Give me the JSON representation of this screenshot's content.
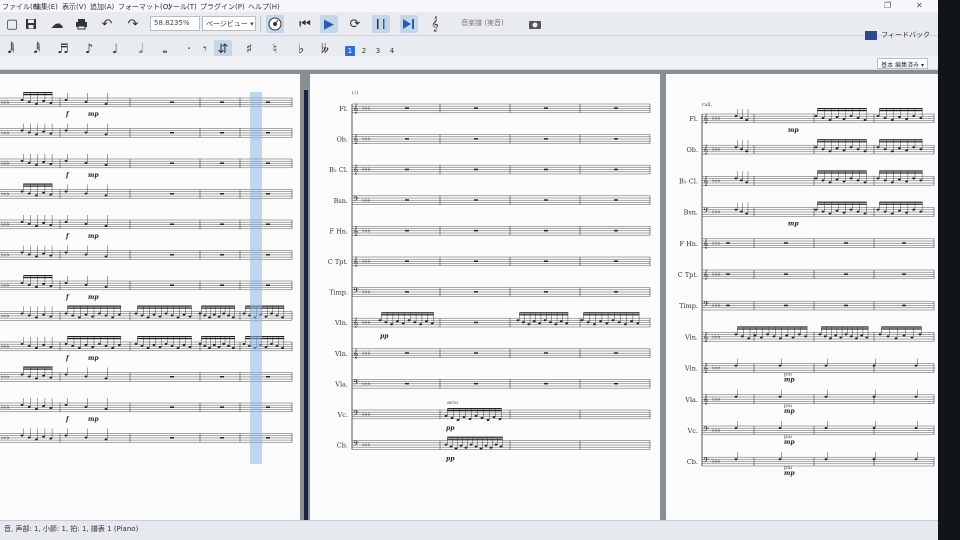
{
  "menubar": {
    "items": [
      "ファイル(F)",
      "編集(E)",
      "表示(V)",
      "追加(A)",
      "フォーマット(O)",
      "ツール(T)",
      "プラグイン(P)",
      "ヘルプ(H)"
    ]
  },
  "toolbar": {
    "zoom_value": "58.8235%",
    "view_mode": "ページビュー",
    "concert_pitch_label": "音楽譜 (実音)",
    "icons": [
      "new-icon",
      "save-icon",
      "cloud-upload-icon",
      "print-icon",
      "undo-icon",
      "redo-icon",
      "metronome-icon",
      "rewind-icon",
      "play-icon",
      "loop-icon",
      "loop-in-icon",
      "loop-out-icon",
      "mixer-icon",
      "camera-icon"
    ]
  },
  "note_input": {
    "voices": [
      "1",
      "2",
      "3",
      "4"
    ],
    "active_voice": "1",
    "icons": [
      "sixty-fourth-note-icon",
      "thirty-second-note-icon",
      "sixteenth-note-icon",
      "eighth-note-icon",
      "quarter-note-icon",
      "half-note-icon",
      "whole-note-icon",
      "augmentation-dot-icon",
      "rest-icon",
      "flip-icon",
      "sharp-icon",
      "natural-icon",
      "flat-icon"
    ]
  },
  "feedback": {
    "label": "フィードバック"
  },
  "workspace": {
    "selected": "基本 編集済み"
  },
  "score": {
    "middle_instruments": [
      "Fl.",
      "Ob.",
      "B♭ Cl.",
      "Bsn.",
      "F Hn.",
      "C Tpt.",
      "Timp.",
      "Vln.",
      "Vln.",
      "Vla.",
      "Vc.",
      "Cb."
    ],
    "right_instruments": [
      "Fl.",
      "Ob.",
      "B♭ Cl.",
      "Bsn.",
      "F Hn.",
      "C Tpt.",
      "Timp.",
      "Vln.",
      "Vln.",
      "Vla.",
      "Vc.",
      "Cb."
    ],
    "middle_tempo": "(♩)",
    "right_tempo": "rall.",
    "dynamics": {
      "f": "f",
      "mp": "mp",
      "pp": "pp",
      "piu": "piu",
      "arco": "arco"
    }
  },
  "statusbar": {
    "text": "音, 声部: 1, 小節: 1, 拍: 1, 譜表 1 (Piano)"
  }
}
